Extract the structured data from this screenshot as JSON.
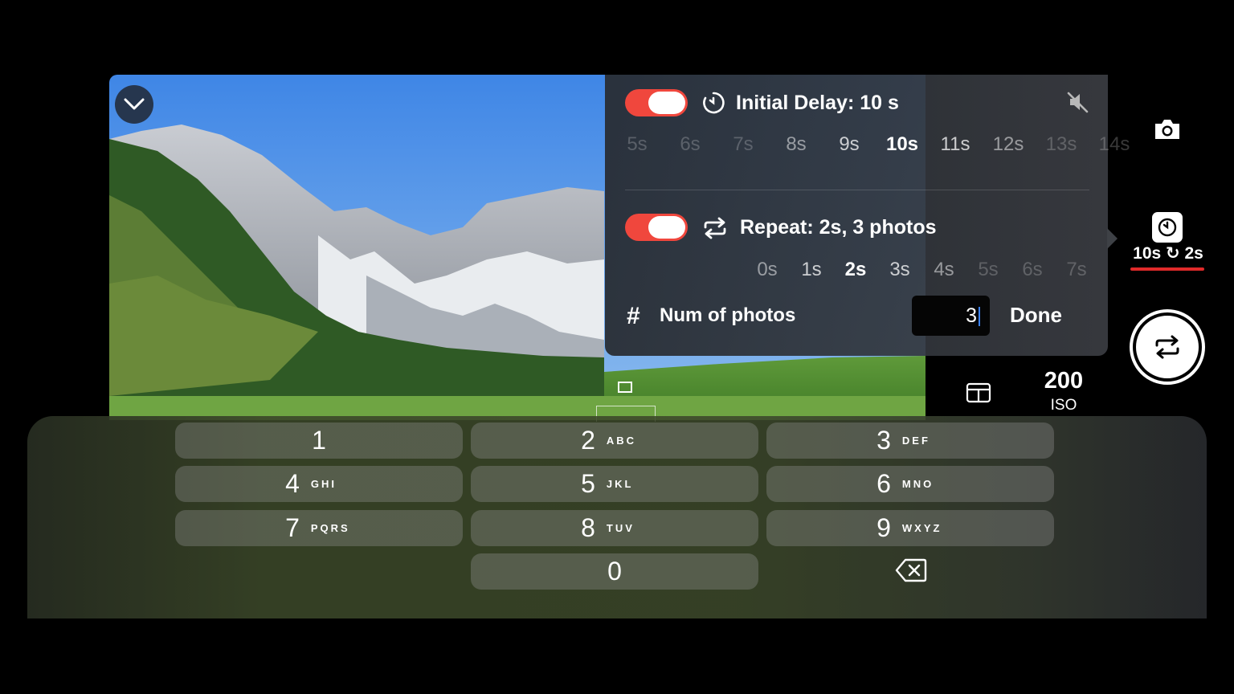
{
  "popover": {
    "initial_delay": {
      "title": "Initial Delay: 10 s",
      "enabled": true,
      "options": [
        "5s",
        "6s",
        "7s",
        "8s",
        "9s",
        "10s",
        "11s",
        "12s",
        "13s",
        "14s"
      ],
      "selected": "10s"
    },
    "repeat": {
      "title": "Repeat: 2s, 3 photos",
      "enabled": true,
      "options": [
        "0s",
        "1s",
        "2s",
        "3s",
        "4s",
        "5s",
        "6s",
        "7s"
      ],
      "selected": "2s"
    },
    "num_photos": {
      "hash": "#",
      "label": "Num of photos",
      "value": "3",
      "done_label": "Done"
    }
  },
  "camera_panel": {
    "timer_summary": "10s ↻ 2s",
    "iso_value": "200",
    "iso_label": "ISO"
  },
  "keypad": {
    "keys": [
      {
        "digit": "1",
        "letters": ""
      },
      {
        "digit": "2",
        "letters": "ABC"
      },
      {
        "digit": "3",
        "letters": "DEF"
      },
      {
        "digit": "4",
        "letters": "GHI"
      },
      {
        "digit": "5",
        "letters": "JKL"
      },
      {
        "digit": "6",
        "letters": "MNO"
      },
      {
        "digit": "7",
        "letters": "PQRS"
      },
      {
        "digit": "8",
        "letters": "TUV"
      },
      {
        "digit": "9",
        "letters": "WXYZ"
      },
      {
        "digit": "0",
        "letters": ""
      }
    ]
  },
  "icons": {
    "collapse": "chevron-down-icon",
    "delay": "timer-icon",
    "repeat": "repeat-icon",
    "mute": "speaker-muted-icon",
    "camera": "camera-icon",
    "timer_button": "timer-icon",
    "shutter": "repeat-icon",
    "layout": "layout-icon",
    "backspace": "backspace-icon"
  },
  "colors": {
    "toggle_on": "#f0473d",
    "accent_underline": "#e02a2a",
    "caret": "#3b82f6"
  }
}
